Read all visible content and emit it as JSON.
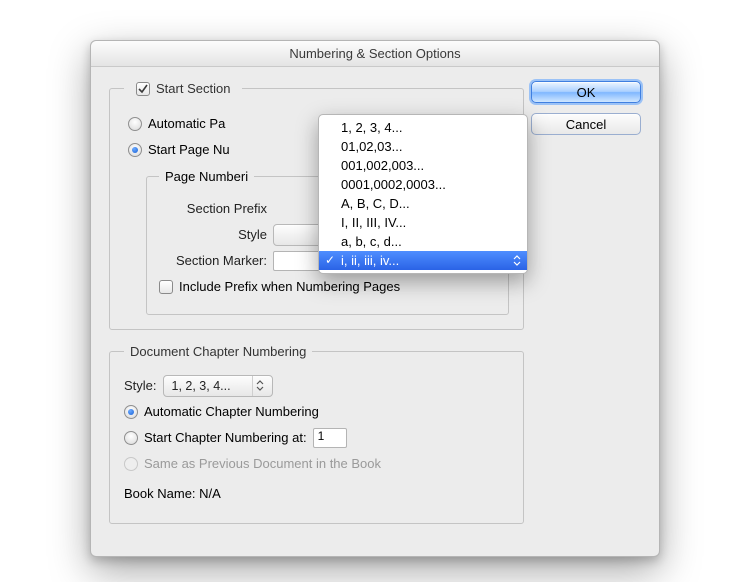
{
  "dialog": {
    "title": "Numbering & Section Options"
  },
  "buttons": {
    "ok": "OK",
    "cancel": "Cancel"
  },
  "start_section": {
    "checkbox_label": "Start Section",
    "checked": true,
    "auto_page_label": "Automatic Pa",
    "start_page_label": "Start Page Nu",
    "page_numbering": {
      "legend": "Page Numberi",
      "section_prefix_label": "Section Prefix",
      "style_label": "Style",
      "section_marker_label": "Section Marker:",
      "section_marker_value": "",
      "include_prefix_label": "Include Prefix when Numbering Pages",
      "include_prefix_checked": false
    }
  },
  "style_options": [
    "1, 2, 3, 4...",
    "01,02,03...",
    "001,002,003...",
    "0001,0002,0003...",
    "A, B, C, D...",
    "I, II, III, IV...",
    "a, b, c, d...",
    "i, ii, iii, iv..."
  ],
  "style_selected_index": 7,
  "chapter": {
    "legend": "Document Chapter Numbering",
    "style_label": "Style:",
    "style_value": "1, 2, 3, 4...",
    "auto_label": "Automatic Chapter Numbering",
    "start_at_label": "Start Chapter Numbering at:",
    "start_at_value": "1",
    "same_as_prev_label": "Same as Previous Document in the Book",
    "book_name_label": "Book Name: N/A"
  }
}
